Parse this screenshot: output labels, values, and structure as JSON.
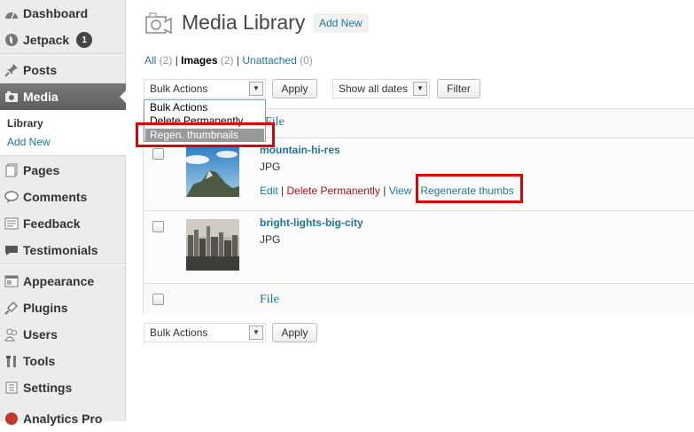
{
  "sidebar": {
    "items": [
      {
        "label": "Dashboard",
        "icon": "dashboard-icon"
      },
      {
        "label": "Jetpack",
        "icon": "jetpack-icon",
        "badge": "1"
      },
      {
        "label": "Posts",
        "icon": "pin-icon"
      },
      {
        "label": "Media",
        "icon": "camera-icon"
      },
      {
        "label": "Pages",
        "icon": "pages-icon"
      },
      {
        "label": "Comments",
        "icon": "comment-icon"
      },
      {
        "label": "Feedback",
        "icon": "feedback-icon"
      },
      {
        "label": "Testimonials",
        "icon": "testimonials-icon"
      },
      {
        "label": "Appearance",
        "icon": "appearance-icon"
      },
      {
        "label": "Plugins",
        "icon": "plug-icon"
      },
      {
        "label": "Users",
        "icon": "users-icon"
      },
      {
        "label": "Tools",
        "icon": "tools-icon"
      },
      {
        "label": "Settings",
        "icon": "settings-icon"
      },
      {
        "label": "Analytics Pro",
        "icon": "analytics-icon"
      }
    ],
    "submenu": {
      "library": "Library",
      "add_new": "Add New"
    }
  },
  "header": {
    "title": "Media Library",
    "add_new": "Add New"
  },
  "filters": {
    "all": "All",
    "all_count": "(2)",
    "images": "Images",
    "images_count": "(2)",
    "unattached": "Unattached",
    "unattached_count": "(0)",
    "sep": "|"
  },
  "controls": {
    "bulk_actions": "Bulk Actions",
    "apply": "Apply",
    "show_dates": "Show all dates",
    "filter": "Filter"
  },
  "bulk_dropdown": {
    "options": [
      "Bulk Actions",
      "Delete Permanently",
      "Regen. thumbnails"
    ],
    "highlighted": "Regen. thumbnails"
  },
  "table": {
    "header_file": "File",
    "footer_file": "File",
    "rows": [
      {
        "title": "mountain-hi-res",
        "type": "JPG",
        "actions": {
          "edit": "Edit",
          "delete": "Delete Permanently",
          "view": "View",
          "regen": "Regenerate thumbs",
          "sep": "|"
        }
      },
      {
        "title": "bright-lights-big-city",
        "type": "JPG"
      }
    ]
  },
  "colors": {
    "link": "#21759b",
    "highlight": "#e00000",
    "delete": "#bc0b0b"
  }
}
